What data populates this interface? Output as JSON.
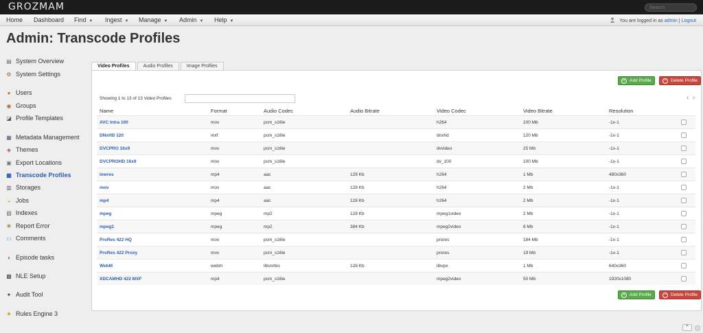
{
  "app": {
    "logo": "GROZMAM",
    "search_placeholder": "Search"
  },
  "menu": {
    "items": [
      {
        "label": "Home",
        "has_caret": false
      },
      {
        "label": "Dashboard",
        "has_caret": false
      },
      {
        "label": "Find",
        "has_caret": true
      },
      {
        "label": "Ingest",
        "has_caret": true
      },
      {
        "label": "Manage",
        "has_caret": true
      },
      {
        "label": "Admin",
        "has_caret": true
      },
      {
        "label": "Help",
        "has_caret": true
      }
    ],
    "login_prefix": "You are logged in as",
    "username": "admin",
    "separator": "|",
    "logout": "Logout"
  },
  "page": {
    "title": "Admin: Transcode Profiles"
  },
  "sidebar": {
    "items": [
      {
        "label": "System Overview",
        "icon": "server-icon",
        "active": false
      },
      {
        "label": "System Settings",
        "icon": "settings-icon",
        "active": false
      },
      {
        "label": "Users",
        "icon": "user-icon",
        "active": false
      },
      {
        "label": "Groups",
        "icon": "group-icon",
        "active": false
      },
      {
        "label": "Profile Templates",
        "icon": "profile-icon",
        "active": false
      },
      {
        "label": "Metadata Management",
        "icon": "metadata-icon",
        "active": false
      },
      {
        "label": "Themes",
        "icon": "themes-icon",
        "active": false
      },
      {
        "label": "Export Locations",
        "icon": "export-icon",
        "active": false
      },
      {
        "label": "Transcode Profiles",
        "icon": "transcode-icon",
        "active": true
      },
      {
        "label": "Storages",
        "icon": "storage-icon",
        "active": false
      },
      {
        "label": "Jobs",
        "icon": "jobs-icon",
        "active": false
      },
      {
        "label": "Indexes",
        "icon": "indexes-icon",
        "active": false
      },
      {
        "label": "Report Error",
        "icon": "bug-icon",
        "active": false
      },
      {
        "label": "Comments",
        "icon": "comments-icon",
        "active": false
      },
      {
        "label": "Episode tasks",
        "icon": "chat-icon",
        "active": false
      },
      {
        "label": "NLE Setup",
        "icon": "nle-icon",
        "active": false
      },
      {
        "label": "Audit Tool",
        "icon": "audit-icon",
        "active": false
      },
      {
        "label": "Rules Engine 3",
        "icon": "rules-icon",
        "active": false
      }
    ]
  },
  "tabs": [
    {
      "label": "Video Profiles",
      "active": true
    },
    {
      "label": "Audio Profiles",
      "active": false
    },
    {
      "label": "Image Profiles",
      "active": false
    }
  ],
  "actions": {
    "add_label": "Add Profile",
    "delete_label": "Delete Profile"
  },
  "table": {
    "showing": "Showing 1 to 13 of 13 Video Profiles",
    "filter_value": "",
    "headers": [
      "Name",
      "Format",
      "Audio Codec",
      "Audio Bitrate",
      "Video Codec",
      "Video Bitrate",
      "Resolution"
    ],
    "rows": [
      [
        "AVC Intra 100",
        "mov",
        "pcm_s16le",
        "",
        "h264",
        "100 Mb",
        "-1x-1"
      ],
      [
        "DNxHD 120",
        "mxf",
        "pcm_s16le",
        "",
        "dnxhd",
        "120 Mb",
        "-1x-1"
      ],
      [
        "DVCPRO 16x9",
        "mov",
        "pcm_s16le",
        "",
        "dvvideo",
        "25 Mb",
        "-1x-1"
      ],
      [
        "DVCPROHD 16x9",
        "mov",
        "pcm_s16le",
        "",
        "dv_100",
        "100 Mb",
        "-1x-1"
      ],
      [
        "lowres",
        "mp4",
        "aac",
        "128 Kb",
        "h264",
        "1 Mb",
        "480x360"
      ],
      [
        "mov",
        "mov",
        "aac",
        "128 Kb",
        "h264",
        "2 Mb",
        "-1x-1"
      ],
      [
        "mp4",
        "mp4",
        "aac",
        "128 Kb",
        "h264",
        "2 Mb",
        "-1x-1"
      ],
      [
        "mpeg",
        "mpeg",
        "mp2",
        "128 Kb",
        "mpeg1video",
        "2 Mb",
        "-1x-1"
      ],
      [
        "mpeg2",
        "mpeg",
        "mp2",
        "384 Kb",
        "mpeg2video",
        "8 Mb",
        "-1x-1"
      ],
      [
        "ProRes 422 HQ",
        "mov",
        "pcm_s16le",
        "",
        "prores",
        "184 Mb",
        "-1x-1"
      ],
      [
        "ProRes 422 Proxy",
        "mov",
        "pcm_s16le",
        "",
        "prores",
        "19 Mb",
        "-1x-1"
      ],
      [
        "WebM",
        "webm",
        "libvorbis",
        "128 Kb",
        "libvpx",
        "1 Mb",
        "640x360"
      ],
      [
        "XDCAMHD 422 MXF",
        "mp4",
        "pcm_s16le",
        "",
        "mpeg2video",
        "50 Mb",
        "1920x1080"
      ]
    ]
  },
  "colors": {
    "accent": "#2a5db0",
    "add": "#5aaa4a",
    "delete": "#c9463d",
    "topbar": "#1c1c1c"
  }
}
